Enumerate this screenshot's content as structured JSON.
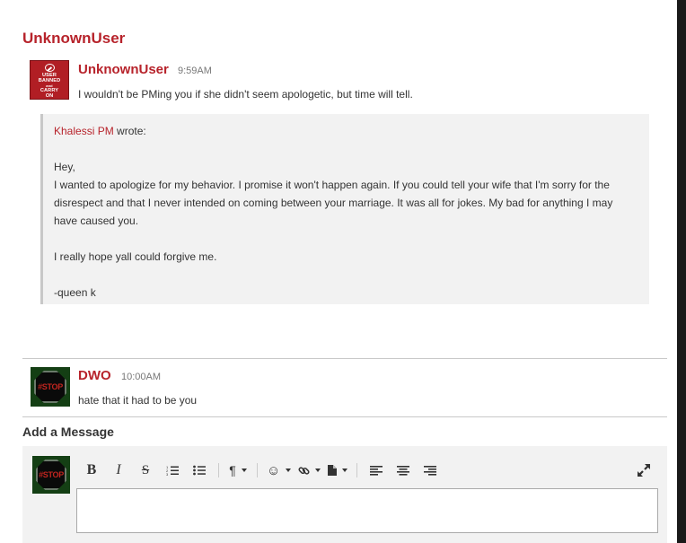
{
  "thread": {
    "title": "UnknownUser"
  },
  "messages": [
    {
      "author": "UnknownUser",
      "time": "9:59AM",
      "avatar": {
        "name": "banned-avatar",
        "lines": [
          "USER",
          "BANNED",
          "and",
          "CARRY",
          "ON"
        ]
      },
      "text": "I wouldn't be PMing you if she didn't seem apologetic, but time will tell.",
      "quote": {
        "author": "Khalessi PM",
        "wrote": " wrote:",
        "lines": [
          "Hey,",
          "I wanted to apologize for my behavior. I promise it won't happen again. If you could tell your wife that I'm sorry for the",
          "disrespect and that I never intended on coming between your marriage. It was all for jokes. My bad for anything I may",
          "have caused you.",
          "",
          "I really hope yall could forgive me.",
          "",
          "-queen k"
        ]
      }
    },
    {
      "author": "DWO",
      "time": "10:00AM",
      "avatar": {
        "name": "stop-avatar",
        "text": "#STOP"
      },
      "text": "hate that it had to be you"
    }
  ],
  "composer": {
    "label": "Add a Message",
    "placeholder": "",
    "avatar_text": "#STOP",
    "toolbar": [
      {
        "name": "bold-button",
        "glyph": "B"
      },
      {
        "name": "italic-button",
        "glyph": "I"
      },
      {
        "name": "strikethrough-button",
        "glyph": "S"
      },
      {
        "name": "ordered-list-button",
        "icon": "ordered-list-icon"
      },
      {
        "name": "unordered-list-button",
        "icon": "unordered-list-icon"
      },
      {
        "name": "paragraph-format-button",
        "glyph": "¶"
      },
      {
        "name": "emoji-button",
        "glyph": "☺"
      },
      {
        "name": "link-button",
        "icon": "link-icon"
      },
      {
        "name": "file-button",
        "icon": "file-icon"
      },
      {
        "name": "align-left-button",
        "icon": "align-left-icon"
      },
      {
        "name": "align-center-button",
        "icon": "align-center-icon"
      },
      {
        "name": "align-right-button",
        "icon": "align-right-icon"
      },
      {
        "name": "fullscreen-button",
        "icon": "expand-icon"
      }
    ]
  },
  "colors": {
    "accent": "#b7232b",
    "quote_bg": "#f2f2f2",
    "text": "#333333"
  }
}
